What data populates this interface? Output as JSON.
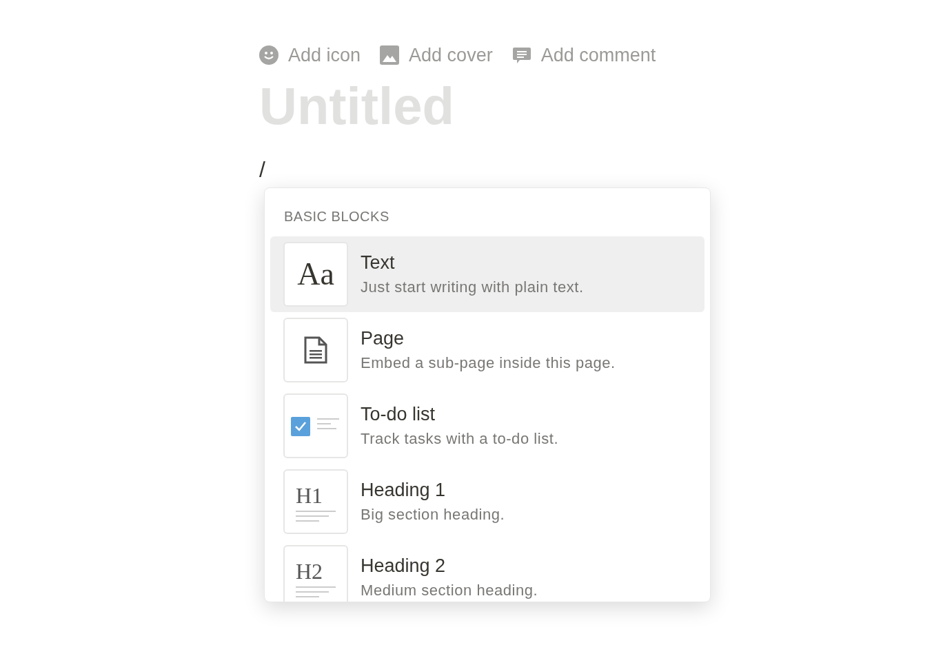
{
  "page_actions": [
    {
      "kind": "icon",
      "label": "Add icon"
    },
    {
      "kind": "cover",
      "label": "Add cover"
    },
    {
      "kind": "comment",
      "label": "Add comment"
    }
  ],
  "title": {
    "placeholder": "Untitled"
  },
  "block": {
    "value": "/"
  },
  "menu": {
    "section": "BASIC BLOCKS",
    "items": [
      {
        "kind": "text",
        "glyph": "Aa",
        "title": "Text",
        "description": "Just start writing with plain text.",
        "selected": true
      },
      {
        "kind": "page",
        "title": "Page",
        "description": "Embed a sub-page inside this page.",
        "selected": false
      },
      {
        "kind": "todo",
        "title": "To-do list",
        "description": "Track tasks with a to-do list.",
        "selected": false
      },
      {
        "kind": "heading",
        "glyph": "H1",
        "title": "Heading 1",
        "description": "Big section heading.",
        "selected": false
      },
      {
        "kind": "heading",
        "glyph": "H2",
        "title": "Heading 2",
        "description": "Medium section heading.",
        "selected": false
      }
    ]
  }
}
